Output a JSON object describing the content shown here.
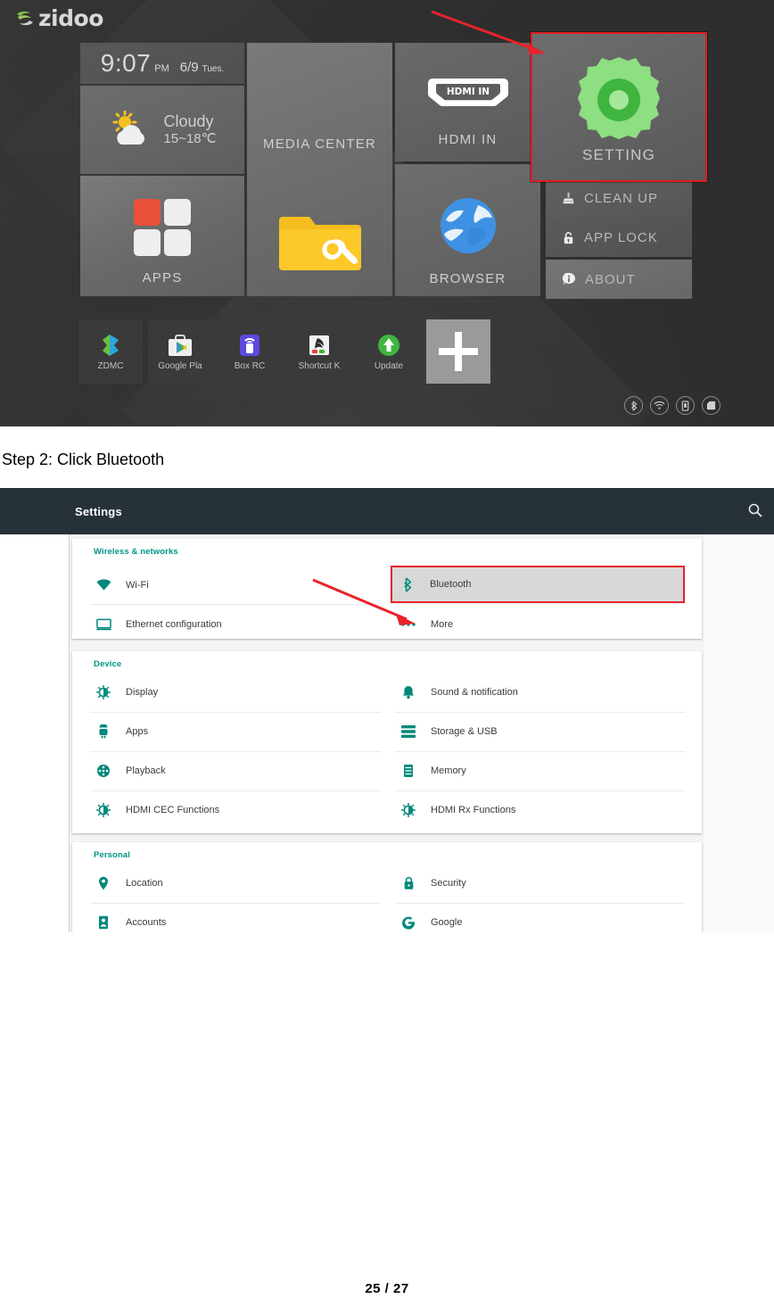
{
  "document": {
    "step_caption": "Step 2: Click Bluetooth",
    "page_number": "25 / 27"
  },
  "launcher": {
    "brand": "zidoo",
    "brand_icon": "zidoo-swoosh-icon",
    "clock": {
      "time": "9:07",
      "ampm": "PM",
      "date": "6/9",
      "weekday": "Tues."
    },
    "weather": {
      "icon": "sun-cloud-icon",
      "condition": "Cloudy",
      "temperature": "15~18℃"
    },
    "tiles": [
      {
        "id": "apps",
        "label": "APPS",
        "icon": "apps-grid-icon"
      },
      {
        "id": "media_center",
        "label": "MEDIA CENTER",
        "icon": "folder-wrench-icon"
      },
      {
        "id": "hdmi_in",
        "label": "HDMI IN",
        "icon": "hdmi-in-badge-icon",
        "badge_text": "HDMI IN"
      },
      {
        "id": "browser",
        "label": "BROWSER",
        "icon": "globe-icon"
      },
      {
        "id": "setting",
        "label": "SETTING",
        "icon": "gear-icon",
        "highlighted": true
      }
    ],
    "menu_items": [
      {
        "id": "clean_up",
        "label": "CLEAN UP",
        "icon": "broom-icon"
      },
      {
        "id": "app_lock",
        "label": "APP LOCK",
        "icon": "lock-icon"
      },
      {
        "id": "about",
        "label": "ABOUT",
        "icon": "info-icon"
      }
    ],
    "dock": [
      {
        "label": "ZDMC",
        "icon": "zdmc-icon"
      },
      {
        "label": "Google Pla",
        "icon": "google-play-icon"
      },
      {
        "label": "Box RC",
        "icon": "box-rc-icon"
      },
      {
        "label": "Shortcut K",
        "icon": "shortcut-key-icon"
      },
      {
        "label": "Update",
        "icon": "update-arrow-icon"
      }
    ],
    "add_shortcut_label": "+",
    "status_icons": [
      "bluetooth-status-icon",
      "wifi-status-icon",
      "usb-drive-status-icon",
      "sd-card-status-icon"
    ],
    "colors": {
      "highlight_red": "#e01b22",
      "gear_green": "#8ede82",
      "accent_orange": "#e8503a"
    }
  },
  "settings": {
    "appbar": {
      "title": "Settings",
      "search_icon": "search-icon"
    },
    "sections": [
      {
        "heading": "Wireless & networks",
        "rows": [
          {
            "label": "Wi-Fi",
            "icon": "wifi-icon",
            "column": "left"
          },
          {
            "label": "Bluetooth",
            "icon": "bluetooth-icon",
            "column": "right",
            "highlighted": true
          },
          {
            "label": "Ethernet configuration",
            "icon": "ethernet-icon",
            "column": "left"
          },
          {
            "label": "More",
            "icon": "more-dots-icon",
            "column": "right"
          }
        ]
      },
      {
        "heading": "Device",
        "rows": [
          {
            "label": "Display",
            "icon": "brightness-icon",
            "column": "left"
          },
          {
            "label": "Sound & notification",
            "icon": "bell-icon",
            "column": "right"
          },
          {
            "label": "Apps",
            "icon": "android-icon",
            "column": "left"
          },
          {
            "label": "Storage & USB",
            "icon": "storage-icon",
            "column": "right"
          },
          {
            "label": "Playback",
            "icon": "playback-icon",
            "column": "left"
          },
          {
            "label": "Memory",
            "icon": "memory-icon",
            "column": "right"
          },
          {
            "label": "HDMI CEC Functions",
            "icon": "brightness-icon",
            "column": "left"
          },
          {
            "label": "HDMI Rx Functions",
            "icon": "brightness-icon",
            "column": "right"
          }
        ]
      },
      {
        "heading": "Personal",
        "rows": [
          {
            "label": "Location",
            "icon": "location-pin-icon",
            "column": "left"
          },
          {
            "label": "Security",
            "icon": "lock-icon",
            "column": "right"
          },
          {
            "label": "Accounts",
            "icon": "account-icon",
            "column": "left"
          },
          {
            "label": "Google",
            "icon": "google-g-icon",
            "column": "right"
          }
        ]
      }
    ],
    "colors": {
      "appbar": "#263238",
      "accent_teal": "#009688",
      "highlight_red": "#e8232a"
    }
  }
}
